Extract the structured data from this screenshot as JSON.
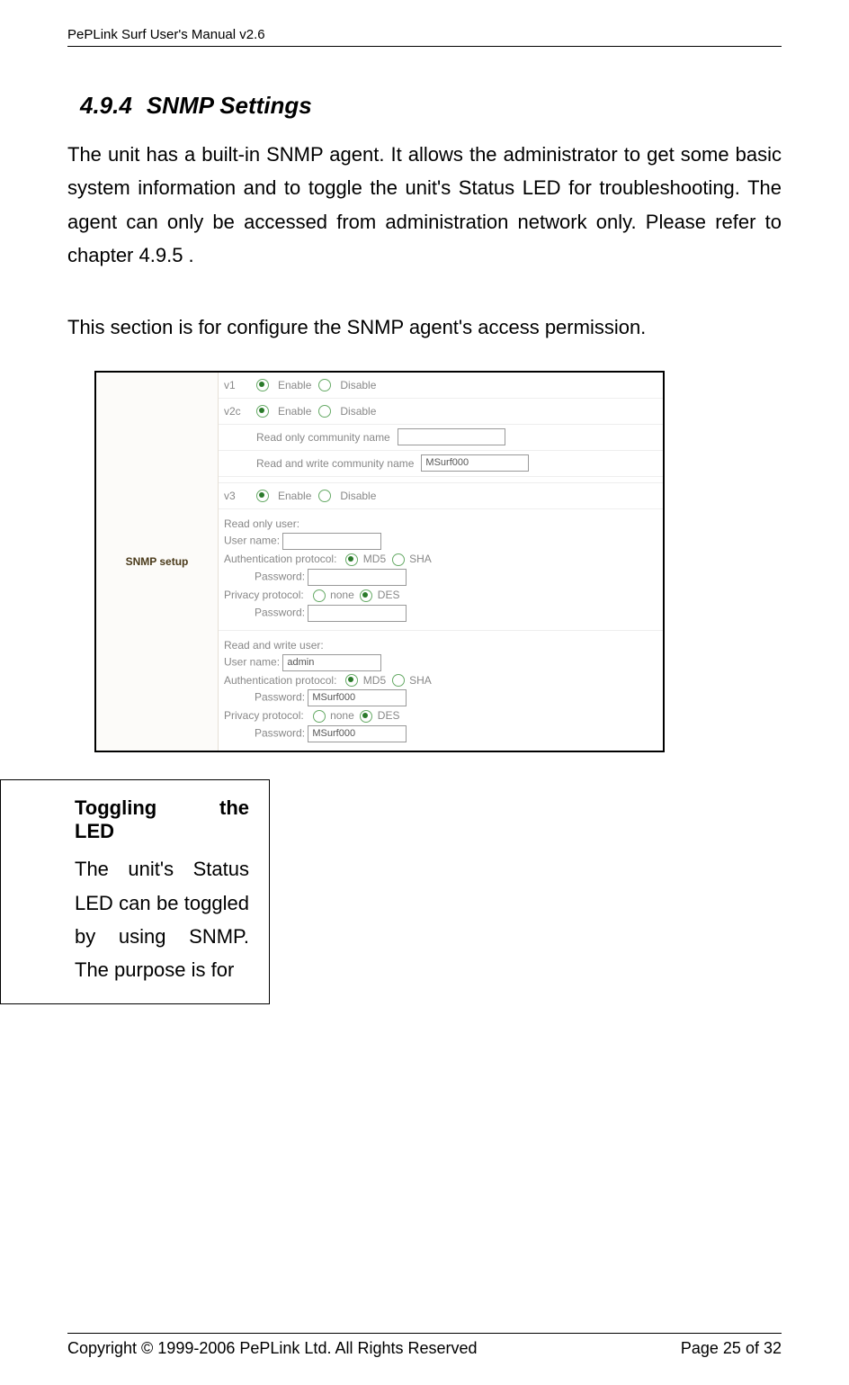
{
  "header": {
    "left": "PePLink Surf User's Manual v2.6"
  },
  "section": {
    "number": "4.9.4",
    "title": "SNMP Settings"
  },
  "paragraphs": {
    "p1": "The unit has a built-in SNMP agent.   It allows the administrator to get some basic system information and to toggle the unit's Status LED for troubleshooting.   The agent can only be accessed from administration network only.    Please refer to chapter 4.9.5 .",
    "p2": "This section is for configure the SNMP agent's access permission."
  },
  "snmp": {
    "sidebar_label": "SNMP setup",
    "v1": {
      "label": "v1",
      "enable": "Enable",
      "disable": "Disable",
      "checked": "enable"
    },
    "v2c": {
      "label": "v2c",
      "enable": "Enable",
      "disable": "Disable",
      "checked": "enable"
    },
    "ro_community_label": "Read only community name",
    "ro_community_value": "",
    "rw_community_label": "Read and write community name",
    "rw_community_value": "MSurf000",
    "v3": {
      "label": "v3",
      "enable": "Enable",
      "disable": "Disable",
      "checked": "enable"
    },
    "ro_user_header": "Read only user:",
    "rw_user_header": "Read and write user:",
    "username_label": "User name:",
    "ro_username_value": "",
    "rw_username_value": "admin",
    "auth_label": "Authentication protocol:",
    "auth_md5": "MD5",
    "auth_sha": "SHA",
    "ro_auth_checked": "md5",
    "rw_auth_checked": "md5",
    "password_label": "Password:",
    "ro_auth_password": "",
    "rw_auth_password": "MSurf000",
    "priv_label": "Privacy protocol:",
    "priv_none": "none",
    "priv_des": "DES",
    "ro_priv_checked": "des",
    "rw_priv_checked": "des",
    "ro_priv_password": "",
    "rw_priv_password": "MSurf000"
  },
  "callout": {
    "title_a": "Toggling",
    "title_b": "the",
    "title_c": "LED",
    "body": "The unit's Status LED can be toggled by using SNMP.  The purpose is for"
  },
  "footer": {
    "left": "Copyright © 1999-2006 PePLink Ltd. All Rights Reserved",
    "right_prefix": "Page ",
    "page_current": "25",
    "right_mid": " of ",
    "page_total": "32"
  }
}
